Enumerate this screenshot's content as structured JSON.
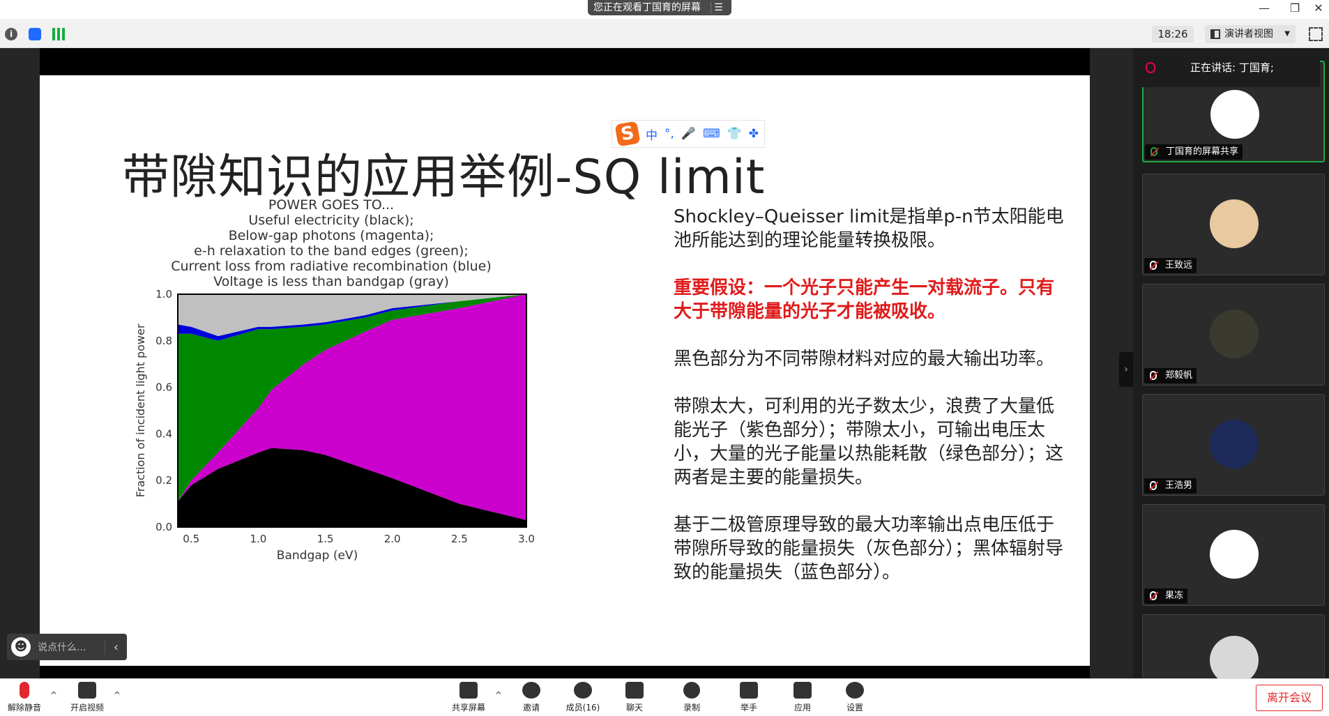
{
  "window": {
    "share_banner": "您正在观看丁国育的屏幕"
  },
  "toolbar": {
    "time": "18:26",
    "view_mode": "演讲者视图"
  },
  "slide": {
    "title": "带隙知识的应用举例-SQ limit",
    "ime": {
      "lang": "中",
      "punct": "°,"
    },
    "paragraphs": [
      {
        "text": "Shockley–Queisser limit是指单p-n节太阳能电池所能达到的理论能量转换极限。",
        "emphasis": false
      },
      {
        "text": "重要假设：一个光子只能产生一对载流子。只有大于带隙能量的光子才能被吸收。",
        "emphasis": true
      },
      {
        "text": "黑色部分为不同带隙材料对应的最大输出功率。",
        "emphasis": false
      },
      {
        "text": "带隙太大，可利用的光子数太少，浪费了大量低能光子（紫色部分）；带隙太小，可输出电压太小，大量的光子能量以热能耗散（绿色部分）；这两者是主要的能量损失。",
        "emphasis": false
      },
      {
        "text": "基于二极管原理导致的最大功率输出点电压低于带隙所导致的能量损失（灰色部分）；黑体辐射导致的能量损失（蓝色部分）。",
        "emphasis": false
      }
    ]
  },
  "chart_data": {
    "type": "area",
    "title_lines": [
      "POWER GOES TO...",
      "Useful electricity (black);",
      "Below-gap photons (magenta);",
      "e-h relaxation to the band edges (green);",
      "Current loss from radiative recombination (blue)",
      "Voltage is less than bandgap (gray)"
    ],
    "xlabel": "Bandgap (eV)",
    "ylabel": "Fraction of incident light power",
    "xlim": [
      0.4,
      3.0
    ],
    "ylim": [
      0.0,
      1.0
    ],
    "xticks": [
      "0.5",
      "1.0",
      "1.5",
      "2.0",
      "2.5",
      "3.0"
    ],
    "yticks": [
      "0.0",
      "0.2",
      "0.4",
      "0.6",
      "0.8",
      "1.0"
    ],
    "x": [
      0.4,
      0.5,
      0.7,
      1.0,
      1.1,
      1.34,
      1.5,
      1.8,
      2.0,
      2.5,
      3.0
    ],
    "series": [
      {
        "color": "#000000",
        "values": [
          0.11,
          0.18,
          0.25,
          0.32,
          0.34,
          0.33,
          0.31,
          0.25,
          0.21,
          0.1,
          0.03
        ]
      },
      {
        "color": "#cc00cc",
        "values": [
          0.0,
          0.02,
          0.07,
          0.19,
          0.25,
          0.37,
          0.45,
          0.59,
          0.68,
          0.84,
          0.97
        ]
      },
      {
        "color": "#008800",
        "values": [
          0.72,
          0.63,
          0.48,
          0.34,
          0.26,
          0.16,
          0.11,
          0.06,
          0.04,
          0.03,
          0.0
        ]
      },
      {
        "color": "#0000dd",
        "values": [
          0.04,
          0.03,
          0.02,
          0.01,
          0.01,
          0.01,
          0.01,
          0.01,
          0.01,
          0.0,
          0.0
        ]
      },
      {
        "color": "#c0c0c0",
        "values": [
          0.13,
          0.14,
          0.18,
          0.14,
          0.14,
          0.13,
          0.12,
          0.09,
          0.06,
          0.03,
          0.0
        ]
      }
    ]
  },
  "chat": {
    "placeholder": "说点什么..."
  },
  "panel": {
    "speaking_label": "正在讲话: 丁国育;",
    "participants": [
      {
        "name": "丁国育的屏幕共享",
        "active": true,
        "avatar_color": "#ffffff"
      },
      {
        "name": "王致远",
        "active": false,
        "avatar_color": "#e8c9a0"
      },
      {
        "name": "郑毅帆",
        "active": false,
        "avatar_color": "#3a3a2e"
      },
      {
        "name": "王浩男",
        "active": false,
        "avatar_color": "#1c2b5a"
      },
      {
        "name": "果冻",
        "active": false,
        "avatar_color": "#ffffff"
      },
      {
        "name": "",
        "active": false,
        "avatar_color": "#d8d8d8"
      }
    ]
  },
  "bottombar": {
    "unmute": "解除静音",
    "start_video": "开启视频",
    "share_screen": "共享屏幕",
    "invite": "邀请",
    "members": "成员(16)",
    "chat": "聊天",
    "record": "录制",
    "raise_hand": "举手",
    "apps": "应用",
    "settings": "设置",
    "leave": "离开会议"
  }
}
